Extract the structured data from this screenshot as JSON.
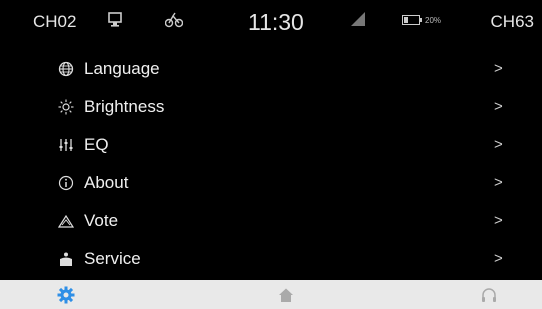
{
  "status": {
    "channel_left": "CH02",
    "time": "11:30",
    "battery_percent": "20%",
    "channel_right": "CH63"
  },
  "menu": {
    "items": [
      {
        "label": "Language",
        "icon": "globe-icon",
        "arrow": ">"
      },
      {
        "label": "Brightness",
        "icon": "sun-icon",
        "arrow": ">"
      },
      {
        "label": "EQ",
        "icon": "equalizer-icon",
        "arrow": ">"
      },
      {
        "label": "About",
        "icon": "info-icon",
        "arrow": ">"
      },
      {
        "label": "Vote",
        "icon": "vote-icon",
        "arrow": ">"
      },
      {
        "label": "Service",
        "icon": "service-icon",
        "arrow": ">"
      }
    ]
  },
  "bottom_nav": {
    "items": [
      {
        "icon": "gear-icon",
        "active": true
      },
      {
        "icon": "home-icon",
        "active": false
      },
      {
        "icon": "headphones-icon",
        "active": false
      }
    ]
  },
  "colors": {
    "background": "#000000",
    "text": "#f0f0f0",
    "bottom_bar": "#e9e9e9",
    "accent": "#2f8fe6",
    "inactive_icon": "#aaaaaa"
  }
}
